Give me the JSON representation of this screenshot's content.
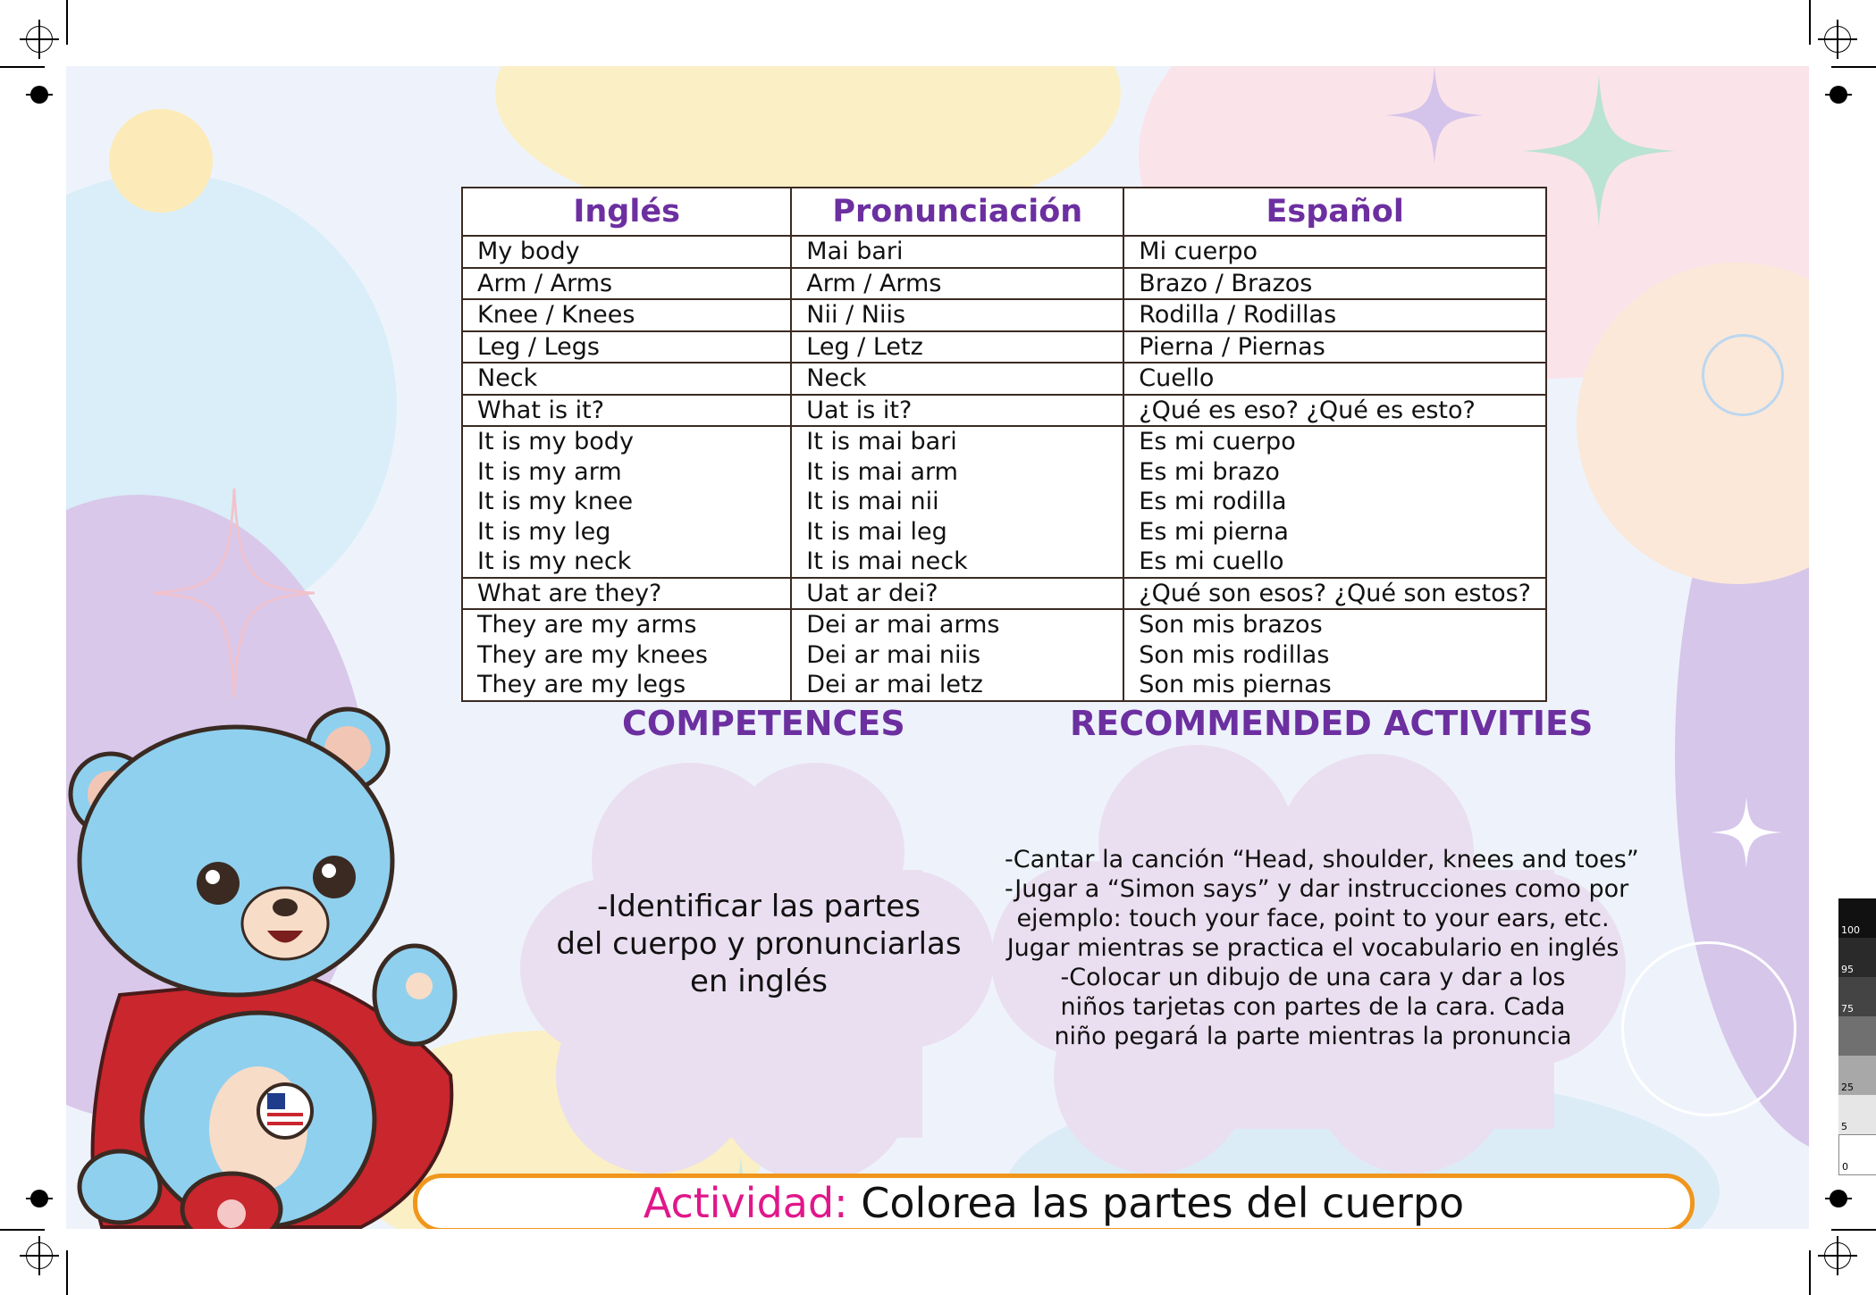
{
  "colors": {
    "heading_purple": "#6c2fa0",
    "activity_pink": "#e0178a",
    "activity_border": "#f0961c",
    "cloud_lavender": "#eadff0",
    "bear_blue": "#8fd0ee",
    "cape_red": "#c9262e"
  },
  "table": {
    "headers": [
      "Inglés",
      "Pronunciación",
      "Español"
    ],
    "rows": [
      [
        [
          "My body"
        ],
        [
          "Mai bari"
        ],
        [
          "Mi cuerpo"
        ]
      ],
      [
        [
          "Arm / Arms"
        ],
        [
          "Arm / Arms"
        ],
        [
          "Brazo / Brazos"
        ]
      ],
      [
        [
          "Knee / Knees"
        ],
        [
          "Nii / Niis"
        ],
        [
          "Rodilla / Rodillas"
        ]
      ],
      [
        [
          "Leg / Legs"
        ],
        [
          "Leg / Letz"
        ],
        [
          "Pierna / Piernas"
        ]
      ],
      [
        [
          "Neck"
        ],
        [
          "Neck"
        ],
        [
          "Cuello"
        ]
      ],
      [
        [
          "What is it?"
        ],
        [
          "Uat is it?"
        ],
        [
          "¿Qué es eso? ¿Qué es esto?"
        ]
      ],
      [
        [
          "It is my body",
          "It is my arm",
          "It is my knee",
          "It is my leg",
          "It is my neck"
        ],
        [
          "It is mai bari",
          "It is mai arm",
          "It is mai nii",
          "It is mai leg",
          "It is mai neck"
        ],
        [
          "Es mi cuerpo",
          "Es mi brazo",
          "Es mi rodilla",
          "Es mi pierna",
          "Es mi cuello"
        ]
      ],
      [
        [
          "What are they?"
        ],
        [
          "Uat ar dei?"
        ],
        [
          "¿Qué son esos? ¿Qué son estos?"
        ]
      ],
      [
        [
          "They are my arms",
          "They are my knees",
          "They are my legs"
        ],
        [
          "Dei ar mai arms",
          "Dei ar mai niis",
          "Dei ar mai letz"
        ],
        [
          "Son mis brazos",
          "Son mis rodillas",
          "Son mis piernas"
        ]
      ]
    ]
  },
  "competences": {
    "title": "COMPETENCES",
    "lines": [
      "-Identificar las partes",
      "del cuerpo y pronunciarlas",
      "en inglés"
    ]
  },
  "activities": {
    "title": "RECOMMENDED ACTIVITIES",
    "lines": [
      "-Cantar la canción “Head, shoulder, knees and toes”",
      "-Jugar a “Simon says” y dar instrucciones como por",
      "ejemplo: touch your face, point to your ears, etc.",
      "Jugar mientras se practica el vocabulario en inglés",
      "-Colocar un dibujo de una cara y dar a los",
      "niños tarjetas con partes de la cara. Cada",
      "niño pegará la parte mientras la pronuncia"
    ]
  },
  "activity_bar": {
    "label": "Actividad:",
    "text": " Colorea las partes del cuerpo"
  },
  "color_bar": {
    "labels": [
      "100",
      "95",
      "75",
      "25",
      "5",
      "0"
    ]
  },
  "mascot": {
    "icon": "bear-mascot-icon",
    "badge_icon": "us-flag-badge-icon"
  }
}
